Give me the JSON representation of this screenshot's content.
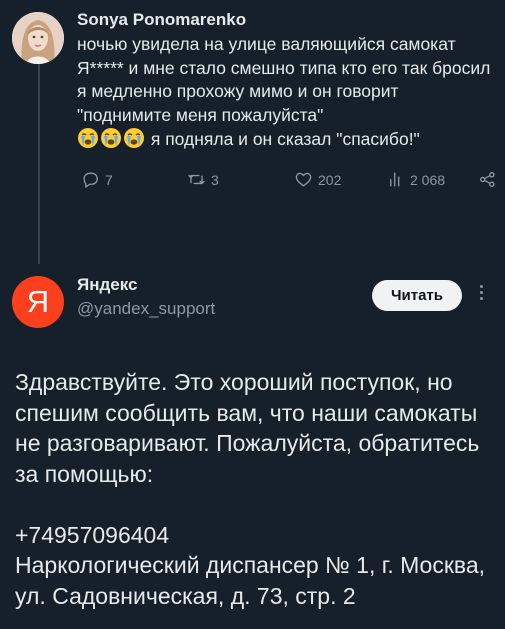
{
  "original_tweet": {
    "author_name": "Sonya Ponomarenko",
    "text_before_emoji": "ночью увидела на улице валяющийся самокат Я***** и мне стало смешно типа кто его так бросил я медленно прохожу мимо и он говорит \"поднимите меня пожалуйста\"\n",
    "emoji": [
      "loudly-crying-face",
      "loudly-crying-face",
      "loudly-crying-face"
    ],
    "text_after_emoji": " я подняла и он сказал \"спасибо!\"",
    "actions": {
      "replies_count": "7",
      "retweets_count": "3",
      "likes_count": "202",
      "views_count": "2 068"
    }
  },
  "reply_tweet": {
    "author_name": "Яндекс",
    "author_handle": "@yandex_support",
    "avatar_letter": "Я",
    "avatar_color": "#fc3f1d",
    "read_button_label": "Читать",
    "text": "Здравствуйте. Это хороший поступок, но спешим сообщить вам, что наши самокаты не разговаривают. Пожалуйста, обратитесь за помощью:\n\n+74957096404\nНаркологический диспансер № 1, г. Москва, ул. Садовническая, д. 73, стр. 2"
  },
  "theme": {
    "background": "#15202b",
    "text_primary": "#e7e9ea",
    "text_secondary": "#8b98a5"
  }
}
